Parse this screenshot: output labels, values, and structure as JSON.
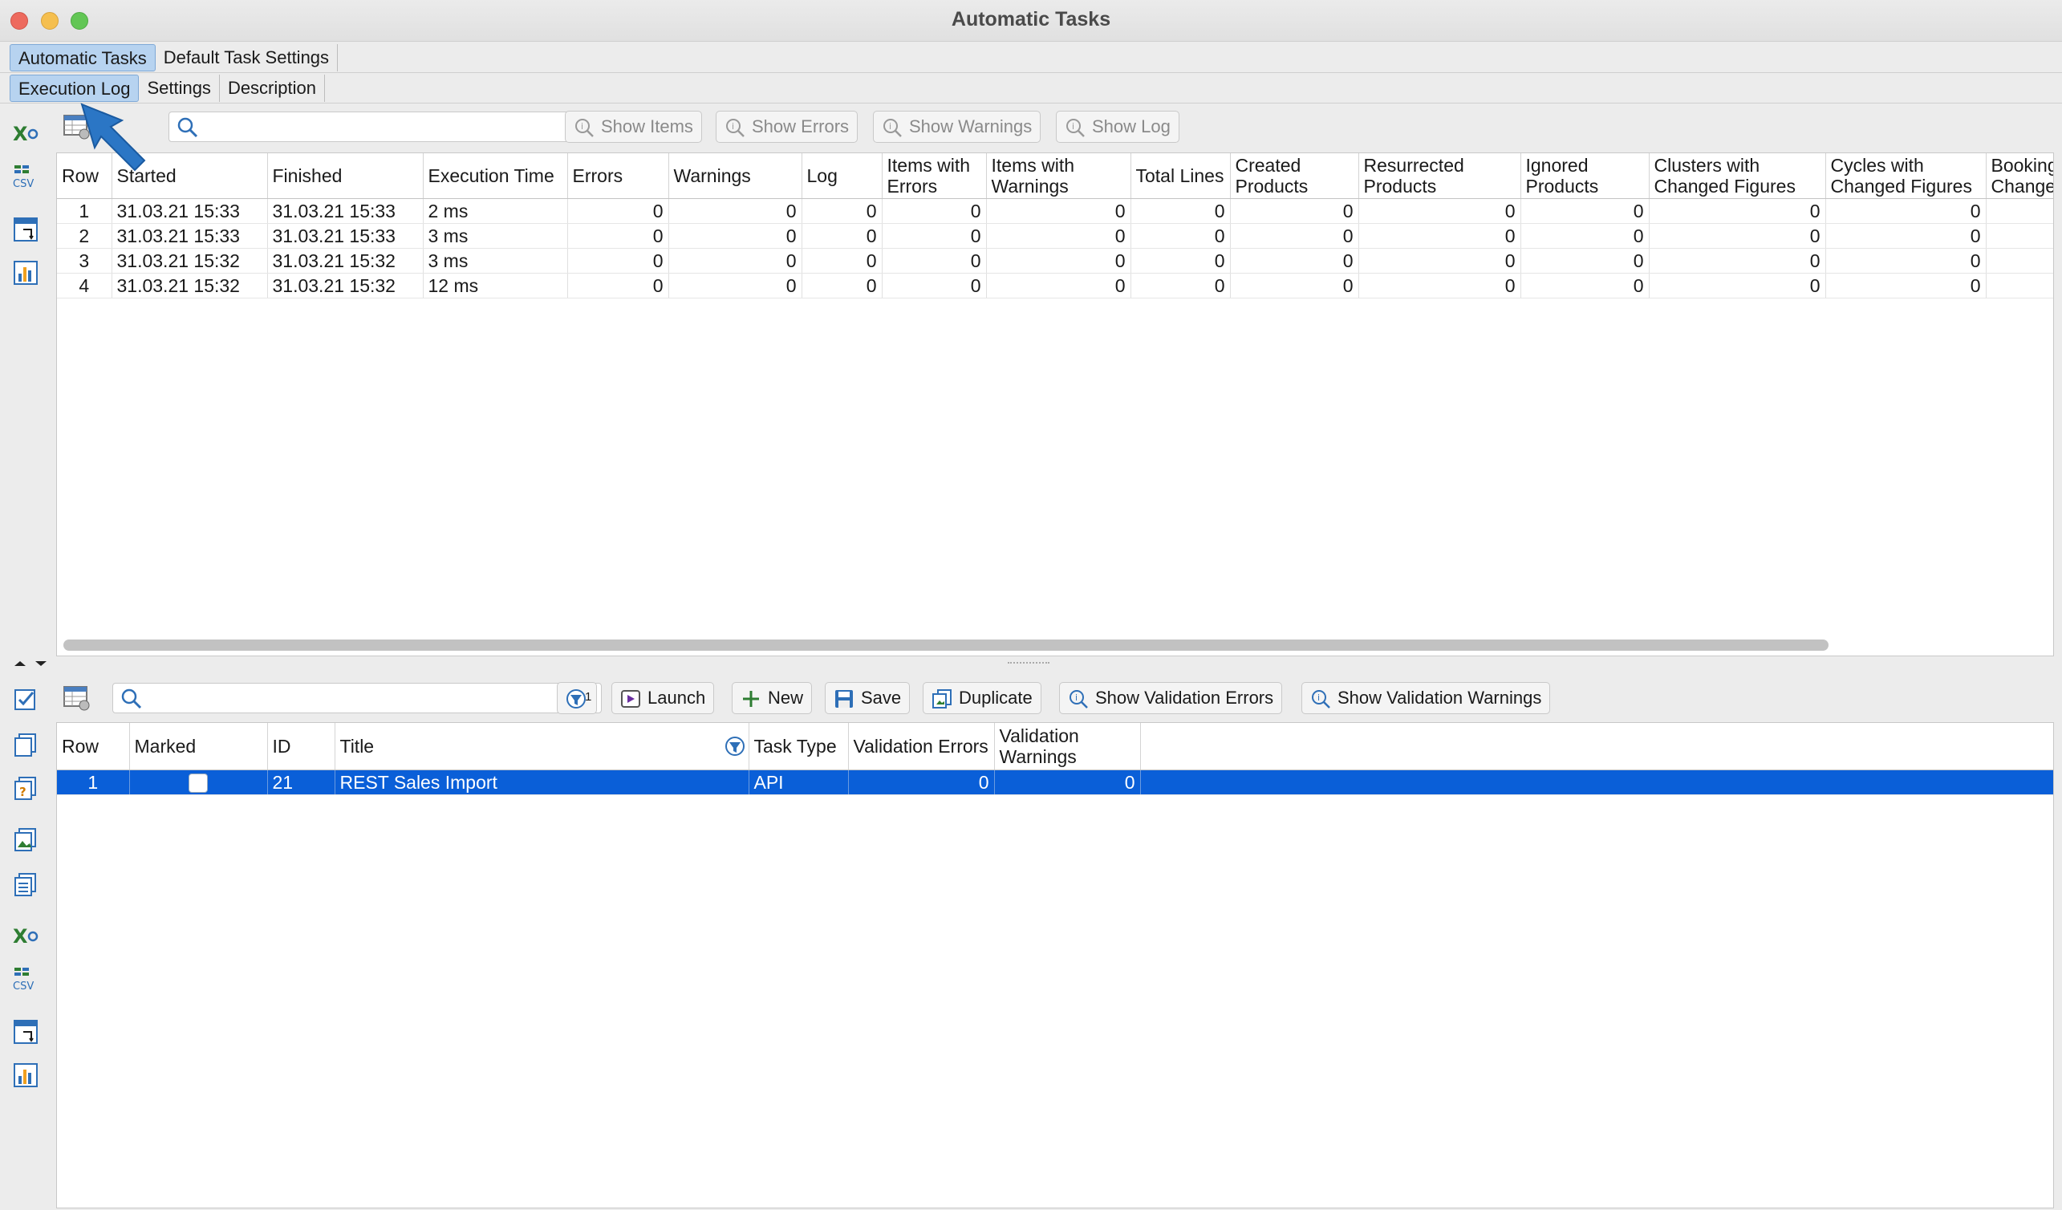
{
  "window": {
    "title": "Automatic Tasks"
  },
  "tabs_main": [
    {
      "label": "Automatic Tasks",
      "active": true
    },
    {
      "label": "Default Task Settings",
      "active": false
    }
  ],
  "tabs_sub": [
    {
      "label": "Execution Log",
      "active": true
    },
    {
      "label": "Settings",
      "active": false
    },
    {
      "label": "Description",
      "active": false
    }
  ],
  "log_toolbar": {
    "search_placeholder": "",
    "show_items": "Show Items",
    "show_errors": "Show Errors",
    "show_warnings": "Show Warnings",
    "show_log": "Show Log"
  },
  "log_table": {
    "columns": [
      "Row",
      "Started",
      "Finished",
      "Execution Time",
      "Errors",
      "Warnings",
      "Log",
      "Items with Errors",
      "Items with Warnings",
      "Total Lines",
      "Created Products",
      "Resurrected Products",
      "Ignored Products",
      "Clusters with Changed Figures",
      "Cycles with Changed Figures",
      "Booking Change"
    ],
    "rows": [
      [
        "1",
        "31.03.21 15:33",
        "31.03.21 15:33",
        "2 ms",
        "0",
        "0",
        "0",
        "0",
        "0",
        "0",
        "0",
        "0",
        "0",
        "0",
        "0",
        ""
      ],
      [
        "2",
        "31.03.21 15:33",
        "31.03.21 15:33",
        "3 ms",
        "0",
        "0",
        "0",
        "0",
        "0",
        "0",
        "0",
        "0",
        "0",
        "0",
        "0",
        ""
      ],
      [
        "3",
        "31.03.21 15:32",
        "31.03.21 15:32",
        "3 ms",
        "0",
        "0",
        "0",
        "0",
        "0",
        "0",
        "0",
        "0",
        "0",
        "0",
        "0",
        ""
      ],
      [
        "4",
        "31.03.21 15:32",
        "31.03.21 15:32",
        "12 ms",
        "0",
        "0",
        "0",
        "0",
        "0",
        "0",
        "0",
        "0",
        "0",
        "0",
        "0",
        ""
      ]
    ]
  },
  "task_toolbar": {
    "search_placeholder": "",
    "filter_badge": "1",
    "launch": "Launch",
    "new": "New",
    "save": "Save",
    "duplicate": "Duplicate",
    "show_validation_errors": "Show Validation Errors",
    "show_validation_warnings": "Show Validation Warnings"
  },
  "task_table": {
    "columns": [
      "Row",
      "Marked",
      "ID",
      "Title",
      "Task Type",
      "Validation Errors",
      "Validation Warnings"
    ],
    "rows": [
      {
        "row": "1",
        "id": "21",
        "title": "REST Sales Import",
        "task_type": "API",
        "validation_errors": "0",
        "validation_warnings": "0",
        "selected": true
      }
    ]
  },
  "colors": {
    "selection": "#0a5fd8",
    "active_tab": "#b7d3f0",
    "icon_blue": "#2e6fb7"
  }
}
